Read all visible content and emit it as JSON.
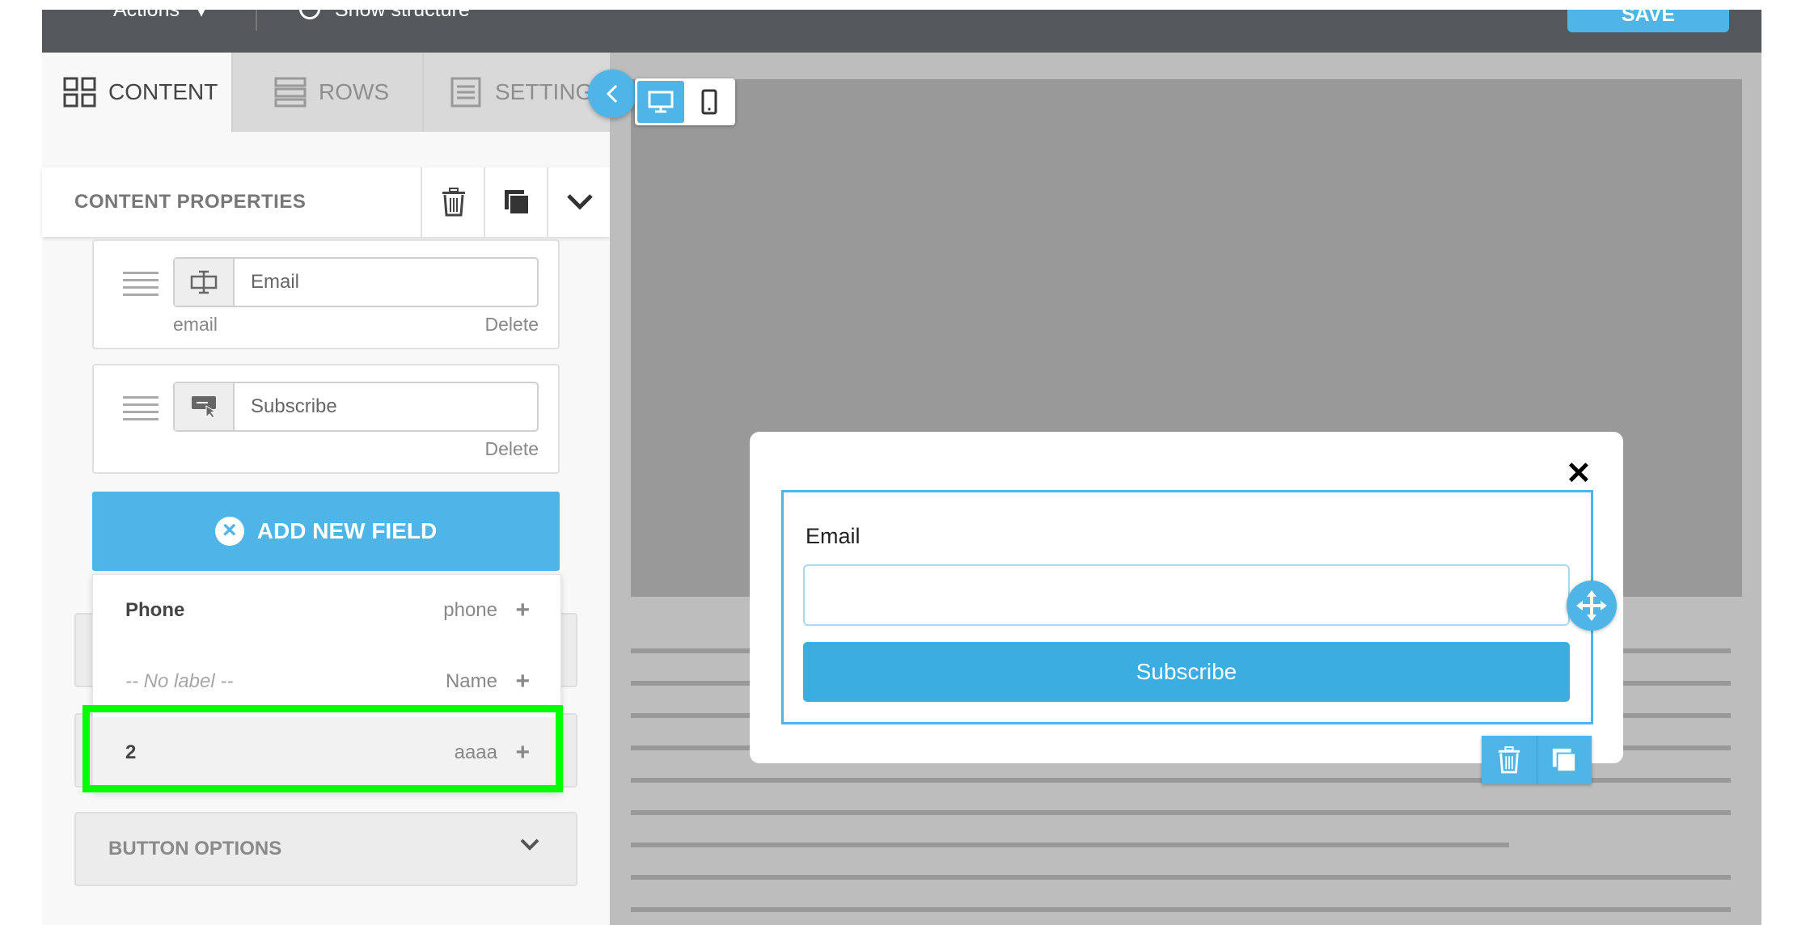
{
  "topbar": {
    "actions_label": "Actions",
    "structure_label": "Show structure",
    "save_label": "SAVE"
  },
  "tabs": [
    {
      "label": "CONTENT",
      "icon": "grid-icon",
      "active": true
    },
    {
      "label": "ROWS",
      "icon": "rows-icon",
      "active": false
    },
    {
      "label": "SETTINGS",
      "icon": "settings-icon",
      "active": false
    }
  ],
  "content_properties": {
    "title": "CONTENT PROPERTIES"
  },
  "fields": [
    {
      "label": "Email",
      "type": "email",
      "delete": "Delete",
      "icon": "text-field-icon"
    },
    {
      "label": "Subscribe",
      "type": "",
      "delete": "Delete",
      "icon": "submit-button-icon"
    }
  ],
  "add_field_label": "ADD NEW FIELD",
  "dropdown": [
    {
      "label": "Phone",
      "key": "phone",
      "muted": false
    },
    {
      "label": "-- No label --",
      "key": "Name",
      "muted": true
    },
    {
      "label": "2",
      "key": "aaaa",
      "muted": false
    }
  ],
  "button_options_label": "BUTTON OPTIONS",
  "preview": {
    "email_label": "Email",
    "email_value": "",
    "subscribe_label": "Subscribe"
  },
  "colors": {
    "accent": "#4fb5e6",
    "highlight": "#00ff00",
    "topbar": "#54585a"
  }
}
